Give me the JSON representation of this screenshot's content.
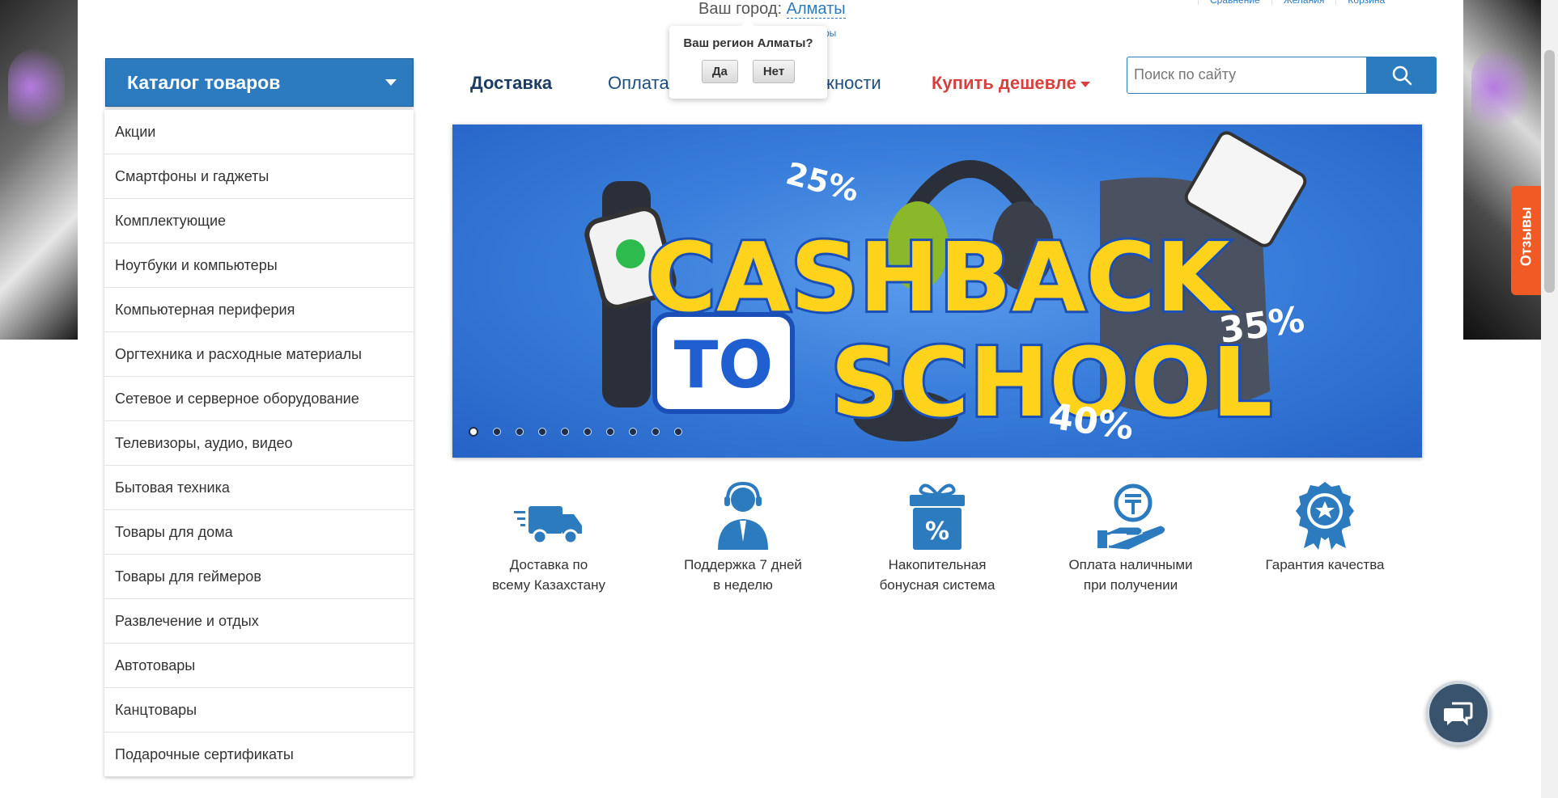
{
  "header": {
    "city_label": "Ваш город:",
    "city_value": "Алматы",
    "top_links": [
      "Сравнение",
      "Желания",
      "Корзина"
    ],
    "stray_text": "ры"
  },
  "region_popup": {
    "question": "Ваш регион Алматы?",
    "yes": "Да",
    "no": "Нет"
  },
  "catalog": {
    "title": "Каталог товаров",
    "items": [
      "Акции",
      "Смартфоны и гаджеты",
      "Комплектующие",
      "Ноутбуки и компьютеры",
      "Компьютерная периферия",
      "Оргтехника и расходные материалы",
      "Сетевое и серверное оборудование",
      "Телевизоры, аудио, видео",
      "Бытовая техника",
      "Товары для дома",
      "Товары для геймеров",
      "Развлечение и отдых",
      "Автотовары",
      "Канцтовары",
      "Подарочные сертификаты"
    ]
  },
  "nav": {
    "delivery": "Доставка",
    "payment": "Оплата",
    "accessories": "ёжности",
    "buy_cheaper": "Купить дешевле"
  },
  "search": {
    "placeholder": "Поиск по сайту"
  },
  "banner": {
    "line1": "CASHBACK",
    "to": "TO",
    "line2": "SCHOOL",
    "pct1": "25%",
    "pct2": "35%",
    "pct3": "40%",
    "slide_count": 10,
    "active_slide": 1
  },
  "features": [
    {
      "icon": "truck-icon",
      "text": "Доставка по\nвсему Казахстану"
    },
    {
      "icon": "support-agent-icon",
      "text": "Поддержка 7 дней\nв неделю"
    },
    {
      "icon": "gift-percent-icon",
      "text": "Накопительная\nбонусная система"
    },
    {
      "icon": "cash-hand-icon",
      "text": "Оплата наличными\nпри получении"
    },
    {
      "icon": "quality-badge-icon",
      "text": "Гарантия качества"
    }
  ],
  "side_tab": {
    "label": "Отзывы"
  },
  "colors": {
    "brand_blue": "#2d7bbf",
    "nav_dark": "#1d3c63",
    "accent_red": "#d84040",
    "tab_orange": "#f15a24",
    "chat_bg": "#39536d"
  }
}
